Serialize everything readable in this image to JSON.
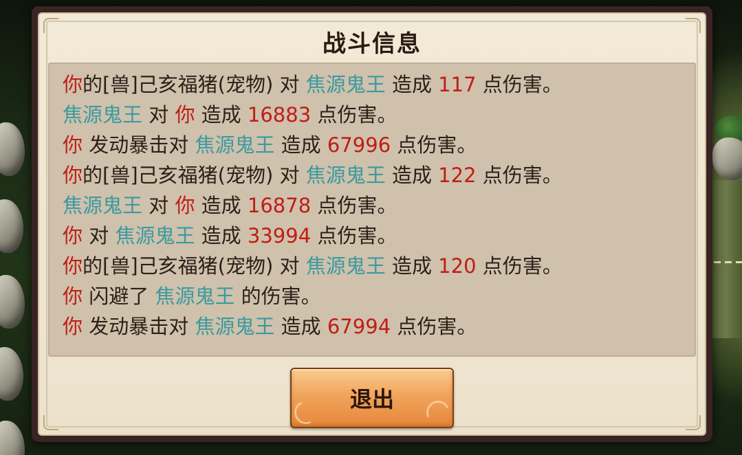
{
  "dialog": {
    "title": "战斗信息",
    "exit_label": "退出"
  },
  "colors": {
    "you": "#c01d15",
    "enemy": "#3a9aa0",
    "number": "#c01d15",
    "plain": "#2e2018"
  },
  "log": [
    [
      {
        "t": "你",
        "c": "you"
      },
      {
        "t": "的[兽]己亥福猪(宠物) 对 ",
        "c": "plain"
      },
      {
        "t": "焦源鬼王",
        "c": "enemy"
      },
      {
        "t": " 造成 ",
        "c": "plain"
      },
      {
        "t": "117",
        "c": "num"
      },
      {
        "t": " 点伤害。",
        "c": "plain"
      }
    ],
    [
      {
        "t": "焦源鬼王",
        "c": "enemy"
      },
      {
        "t": " 对 ",
        "c": "plain"
      },
      {
        "t": "你",
        "c": "you"
      },
      {
        "t": " 造成 ",
        "c": "plain"
      },
      {
        "t": "16883",
        "c": "num"
      },
      {
        "t": " 点伤害。",
        "c": "plain"
      }
    ],
    [
      {
        "t": "你",
        "c": "you"
      },
      {
        "t": " 发动暴击对 ",
        "c": "plain"
      },
      {
        "t": "焦源鬼王",
        "c": "enemy"
      },
      {
        "t": " 造成 ",
        "c": "plain"
      },
      {
        "t": "67996",
        "c": "num"
      },
      {
        "t": " 点伤害。",
        "c": "plain"
      }
    ],
    [
      {
        "t": "你",
        "c": "you"
      },
      {
        "t": "的[兽]己亥福猪(宠物) 对 ",
        "c": "plain"
      },
      {
        "t": "焦源鬼王",
        "c": "enemy"
      },
      {
        "t": " 造成 ",
        "c": "plain"
      },
      {
        "t": "122",
        "c": "num"
      },
      {
        "t": " 点伤害。",
        "c": "plain"
      }
    ],
    [
      {
        "t": "焦源鬼王",
        "c": "enemy"
      },
      {
        "t": " 对 ",
        "c": "plain"
      },
      {
        "t": "你",
        "c": "you"
      },
      {
        "t": " 造成 ",
        "c": "plain"
      },
      {
        "t": "16878",
        "c": "num"
      },
      {
        "t": " 点伤害。",
        "c": "plain"
      }
    ],
    [
      {
        "t": "你",
        "c": "you"
      },
      {
        "t": " 对 ",
        "c": "plain"
      },
      {
        "t": "焦源鬼王",
        "c": "enemy"
      },
      {
        "t": " 造成 ",
        "c": "plain"
      },
      {
        "t": "33994",
        "c": "num"
      },
      {
        "t": " 点伤害。",
        "c": "plain"
      }
    ],
    [
      {
        "t": "你",
        "c": "you"
      },
      {
        "t": "的[兽]己亥福猪(宠物) 对 ",
        "c": "plain"
      },
      {
        "t": "焦源鬼王",
        "c": "enemy"
      },
      {
        "t": " 造成 ",
        "c": "plain"
      },
      {
        "t": "120",
        "c": "num"
      },
      {
        "t": " 点伤害。",
        "c": "plain"
      }
    ],
    [
      {
        "t": "你",
        "c": "you"
      },
      {
        "t": " 闪避了 ",
        "c": "plain"
      },
      {
        "t": "焦源鬼王",
        "c": "enemy"
      },
      {
        "t": " 的伤害。",
        "c": "plain"
      }
    ],
    [
      {
        "t": "你",
        "c": "you"
      },
      {
        "t": " 发动暴击对 ",
        "c": "plain"
      },
      {
        "t": "焦源鬼王",
        "c": "enemy"
      },
      {
        "t": " 造成 ",
        "c": "plain"
      },
      {
        "t": "67994",
        "c": "num"
      },
      {
        "t": " 点伤害。",
        "c": "plain"
      }
    ]
  ]
}
